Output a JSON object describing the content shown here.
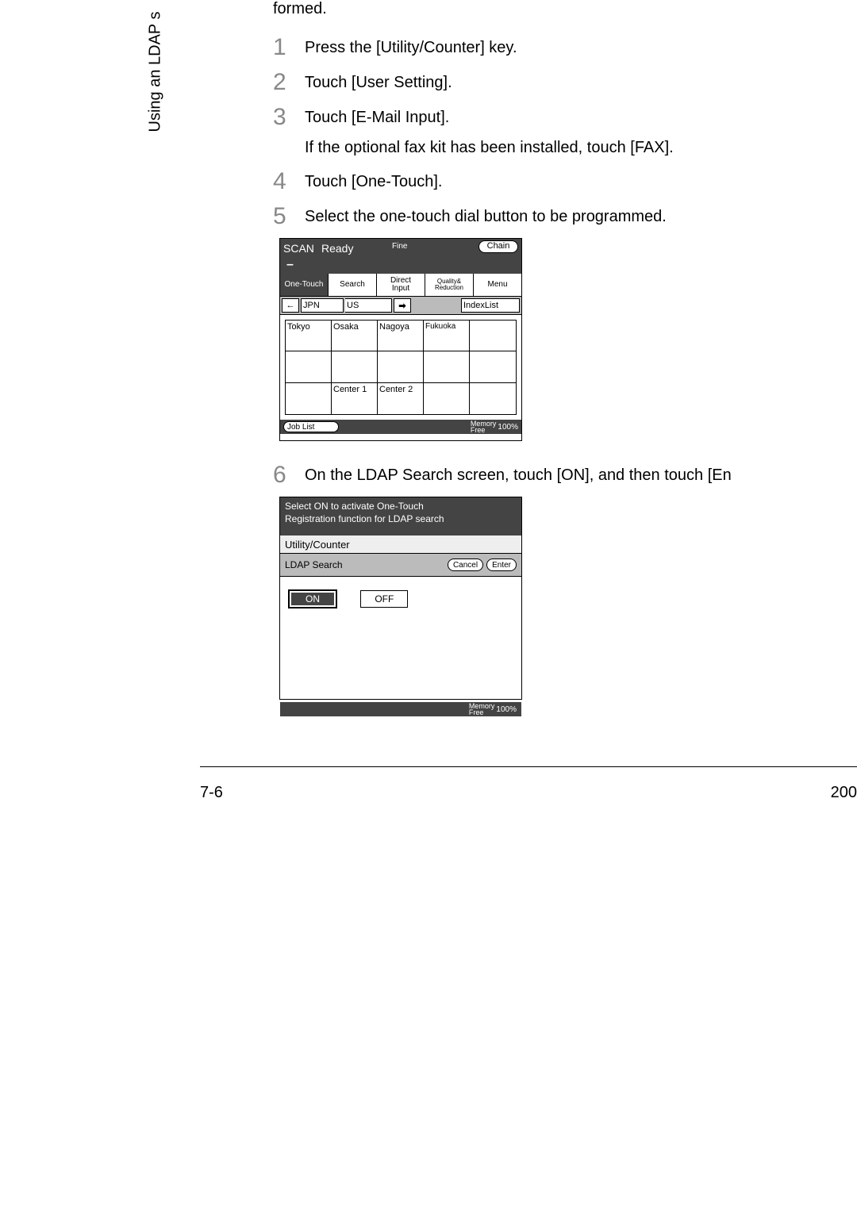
{
  "side_label": "Using an LDAP s",
  "intro_cutoff": "formed.",
  "steps": {
    "1": {
      "text": "Press the [Utility/Counter] key."
    },
    "2": {
      "text": "Touch [User Setting]."
    },
    "3": {
      "text": "Touch [E-Mail Input].",
      "sub": "If the optional fax kit has been installed, touch [FAX]."
    },
    "4": {
      "text": "Touch [One-Touch]."
    },
    "5": {
      "text": "Select the one-touch dial button to be programmed."
    },
    "6": {
      "text": "On the LDAP Search screen, touch [ON], and then touch [En"
    }
  },
  "screen1": {
    "scan": "SCAN",
    "ready": "Ready",
    "fine": "Fine",
    "chain": "Chain",
    "dash": "–",
    "tabs": [
      "One-Touch",
      "Search",
      "Direct\nInput",
      "Quality&\nReduction",
      "Menu"
    ],
    "arr_left": "←",
    "jpn": "JPN",
    "us": "US",
    "arr_right": "➡",
    "indexlist": "IndexList",
    "cells": [
      "Tokyo",
      "Osaka",
      "Nagoya",
      "Fukuoka",
      "",
      "",
      "",
      "",
      "",
      "",
      "",
      "Center 1",
      "Center 2",
      "",
      ""
    ],
    "joblist": "Job List",
    "mem_label": "Memory\nFree",
    "mem_pct": "100%"
  },
  "screen2": {
    "msg1": "Select ON to activate One-Touch",
    "msg2": "Registration function for LDAP search",
    "util": "Utility/Counter",
    "ldap": "LDAP Search",
    "cancel": "Cancel",
    "enter": "Enter",
    "on": "ON",
    "off": "OFF",
    "mem_label": "Memory\nFree",
    "mem_pct": "100%"
  },
  "footer": {
    "left": "7-6",
    "right": "200"
  }
}
